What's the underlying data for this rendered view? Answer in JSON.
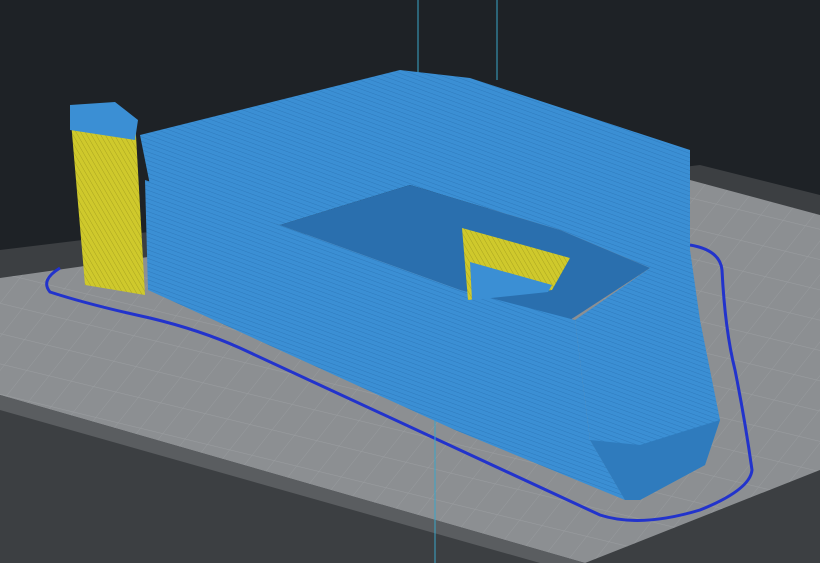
{
  "viewport": {
    "view": "layer-preview",
    "colors": {
      "background": "#1e2226",
      "plate_rim": "#3c3f42",
      "plate_surface": "#8c8f92",
      "grid": "#9fa2a5",
      "model_wall": "#3b8fd4",
      "model_dark": "#2a6fae",
      "support": "#c9c52a",
      "skirt": "#2233cc",
      "axis_line": "#3aa6c8"
    }
  }
}
